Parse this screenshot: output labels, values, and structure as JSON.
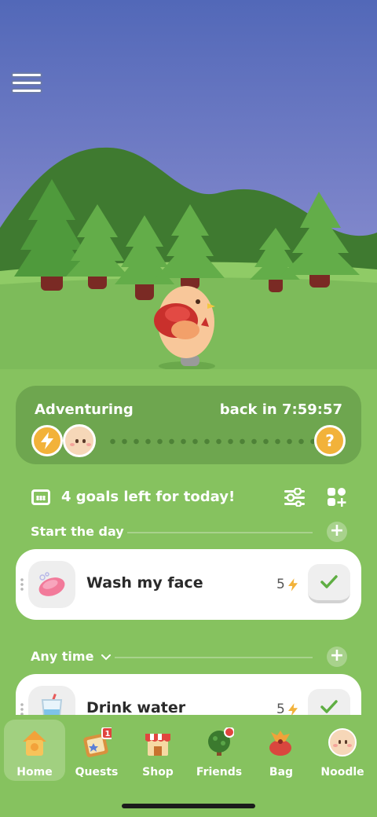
{
  "adventure": {
    "title": "Adventuring",
    "time": "back in 7:59:57"
  },
  "goals": {
    "summary": "4 goals left for today!"
  },
  "sections": [
    {
      "label": "Start the day",
      "items": [
        {
          "title": "Wash my face",
          "points": "5",
          "icon": "soap-icon"
        }
      ]
    },
    {
      "label": "Any time",
      "items": [
        {
          "title": "Drink water",
          "points": "5",
          "icon": "water-glass-icon"
        }
      ]
    }
  ],
  "tabs": [
    {
      "label": "Home",
      "icon": "home-icon",
      "active": true
    },
    {
      "label": "Quests",
      "icon": "quests-icon",
      "badge": "1"
    },
    {
      "label": "Shop",
      "icon": "shop-icon"
    },
    {
      "label": "Friends",
      "icon": "friends-tree-icon"
    },
    {
      "label": "Bag",
      "icon": "bag-icon"
    },
    {
      "label": "Noodle",
      "icon": "noodle-face-icon"
    }
  ],
  "colors": {
    "sky_top": "#5268b8",
    "sky_bottom": "#9a98d6",
    "grass": "#86c25f",
    "accent": "#f2b23a"
  }
}
